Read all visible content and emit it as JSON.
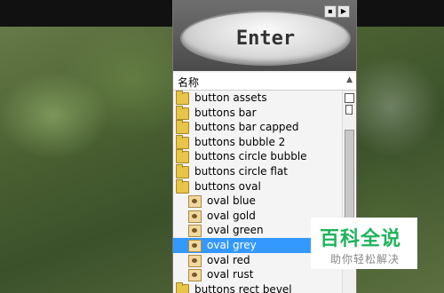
{
  "preview": {
    "button_label": "Enter"
  },
  "list_header": {
    "column_label": "名称"
  },
  "items": [
    {
      "label": "button assets",
      "type": "folder",
      "indent": 0,
      "selected": false
    },
    {
      "label": "buttons bar",
      "type": "folder",
      "indent": 0,
      "selected": false
    },
    {
      "label": "buttons bar capped",
      "type": "folder",
      "indent": 0,
      "selected": false
    },
    {
      "label": "buttons bubble 2",
      "type": "folder",
      "indent": 0,
      "selected": false
    },
    {
      "label": "buttons circle bubble",
      "type": "folder",
      "indent": 0,
      "selected": false
    },
    {
      "label": "buttons circle flat",
      "type": "folder",
      "indent": 0,
      "selected": false
    },
    {
      "label": "buttons oval",
      "type": "folder",
      "indent": 0,
      "selected": false
    },
    {
      "label": "oval blue",
      "type": "style",
      "indent": 1,
      "selected": false
    },
    {
      "label": "oval gold",
      "type": "style",
      "indent": 1,
      "selected": false
    },
    {
      "label": "oval green",
      "type": "style",
      "indent": 1,
      "selected": false
    },
    {
      "label": "oval grey",
      "type": "style",
      "indent": 1,
      "selected": true
    },
    {
      "label": "oval red",
      "type": "style",
      "indent": 1,
      "selected": false
    },
    {
      "label": "oval rust",
      "type": "style",
      "indent": 1,
      "selected": false
    },
    {
      "label": "buttons rect bevel",
      "type": "folder",
      "indent": 0,
      "selected": false
    }
  ],
  "watermark": {
    "title": "百科全说",
    "subtitle": "助你轻松解决"
  },
  "colors": {
    "selection": "#3399ff",
    "watermark_green": "#1fb35a"
  }
}
